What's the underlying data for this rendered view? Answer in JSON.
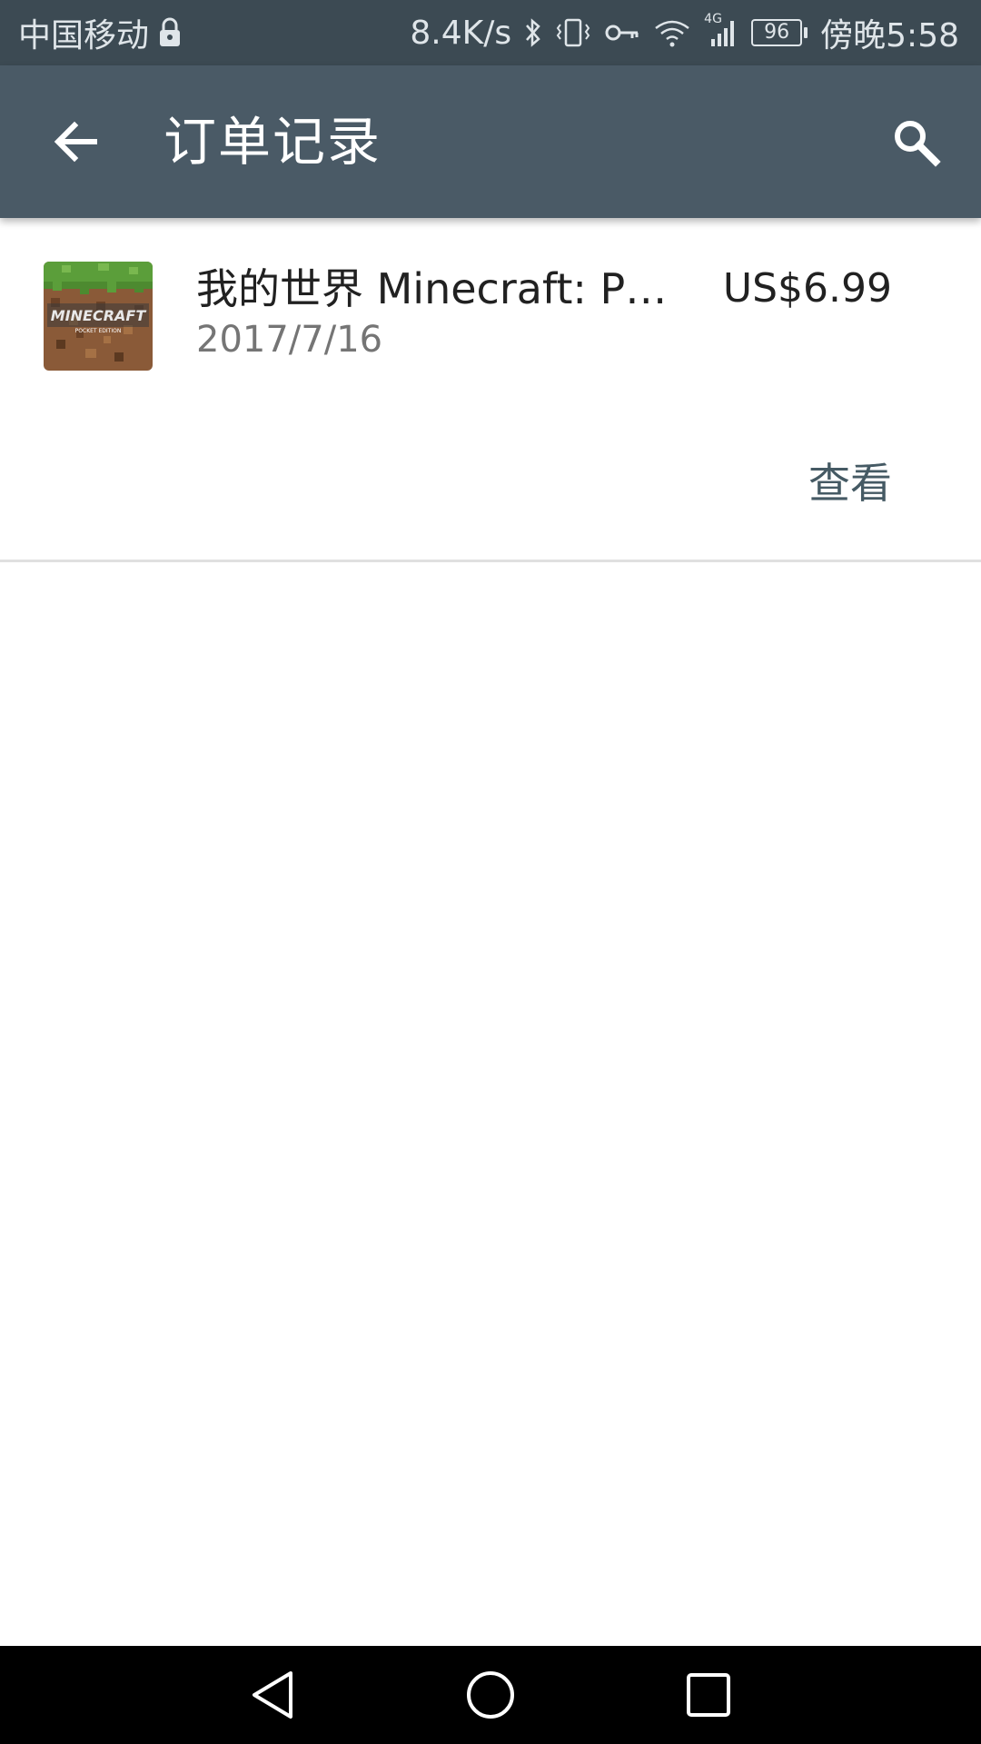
{
  "status_bar": {
    "carrier": "中国移动",
    "speed": "8.4K/s",
    "network": "4G",
    "battery": "96",
    "time": "傍晚5:58",
    "icons": [
      "lock-icon",
      "bluetooth-icon",
      "vibrate-icon",
      "key-icon",
      "wifi-icon",
      "signal-icon",
      "battery-icon"
    ]
  },
  "app_bar": {
    "title": "订单记录",
    "back_icon": "arrow-back-icon",
    "search_icon": "search-icon"
  },
  "orders": [
    {
      "title": "我的世界 Minecraft: P…",
      "date": "2017/7/16",
      "price": "US$6.99",
      "icon": "minecraft-app-icon",
      "action_label": "查看"
    }
  ],
  "nav_bar": {
    "icons": [
      "nav-back-icon",
      "nav-home-icon",
      "nav-recents-icon"
    ]
  },
  "colors": {
    "status_bar": "#3c4a53",
    "app_bar": "#4a5a66",
    "action": "#455a64"
  }
}
